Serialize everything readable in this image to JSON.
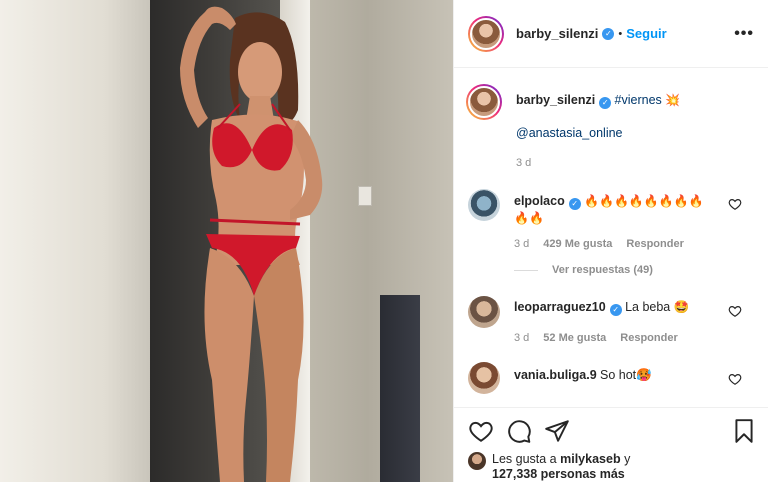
{
  "header": {
    "username": "barby_silenzi",
    "dot": "•",
    "follow_label": "Seguir",
    "more_label": "•••"
  },
  "caption": {
    "username": "barby_silenzi",
    "hashtag": "#viernes",
    "emoji": "💥",
    "mention": "@anastasia_online",
    "time": "3 d"
  },
  "comments": [
    {
      "username": "elpolaco",
      "text_line1": "🔥🔥🔥🔥🔥🔥🔥🔥",
      "text_line2": "🔥🔥",
      "time": "3 d",
      "likes": "429 Me gusta",
      "reply": "Responder",
      "view_replies": "Ver respuestas (49)"
    },
    {
      "username": "leoparraguez10",
      "text": "La beba 🤩",
      "time": "3 d",
      "likes": "52 Me gusta",
      "reply": "Responder"
    },
    {
      "username": "vania.buliga.9",
      "text": "So hot🥵"
    }
  ],
  "footer": {
    "likes_prefix": "Les gusta a",
    "likes_user": "milykaseb",
    "likes_and": "y",
    "likes_count": "127,338 personas más"
  },
  "colors": {
    "accent": "#0095f6",
    "verified": "#3897f0",
    "text": "#262626",
    "muted": "#8e8e8e"
  },
  "icons": [
    "verified-badge-icon",
    "heart-icon",
    "comment-icon",
    "share-icon",
    "bookmark-icon",
    "more-icon"
  ]
}
